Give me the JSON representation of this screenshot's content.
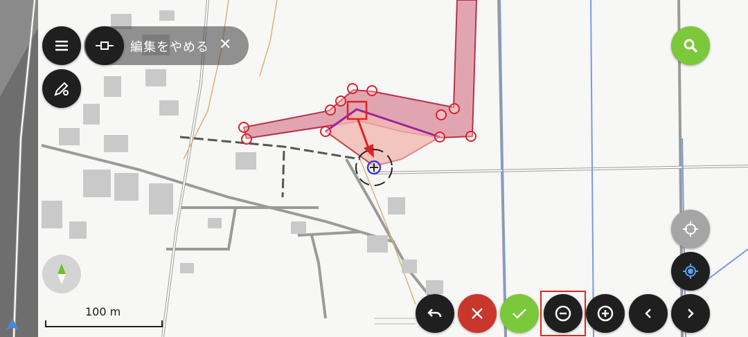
{
  "toolbar": {
    "edit_stop_label": "編集をやめる",
    "close_symbol": "✕"
  },
  "scale": {
    "label": "100 m"
  },
  "colors": {
    "polygon_fill": "#d98a9a",
    "polygon_stroke": "#b8304e",
    "edit_fill": "#f0b8b2",
    "edit_line": "#a0209c",
    "vertex": "#e02020",
    "cursor_ring": "#3a3ad8",
    "green": "#7bc83a",
    "red": "#c9362b",
    "dark": "#1f1f1f"
  },
  "icons": {
    "menu": "menu-icon",
    "line_edit": "line-segment-icon",
    "edit_settings": "pen-gear-icon",
    "search": "search-icon",
    "gps_off": "crosshair-icon",
    "gps_on": "locate-icon",
    "compass": "compass-icon",
    "undo": "undo-icon",
    "cancel": "close-icon",
    "confirm": "check-icon",
    "remove_vertex": "minus-circle-icon",
    "add_vertex": "plus-circle-icon",
    "prev": "chevron-left-icon",
    "next": "chevron-right-icon"
  }
}
